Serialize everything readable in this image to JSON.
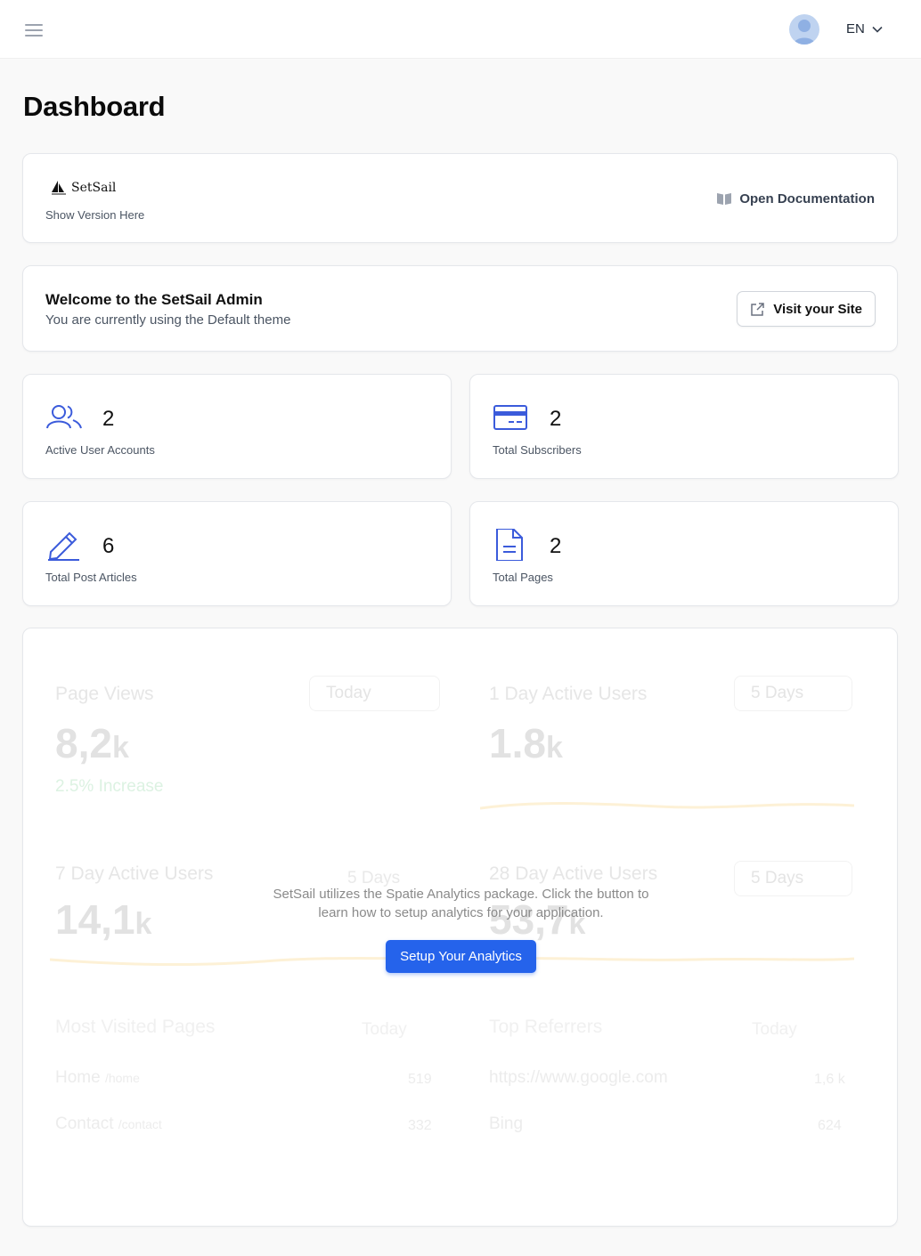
{
  "header": {
    "language": "EN"
  },
  "page": {
    "title": "Dashboard"
  },
  "version_card": {
    "logo_text": "SetSail",
    "version_text": "Show Version Here",
    "docs_label": "Open Documentation"
  },
  "welcome_card": {
    "heading": "Welcome to the SetSail Admin",
    "subtext": "You are currently using the Default theme",
    "visit_label": "Visit your Site"
  },
  "stats": [
    {
      "value": "2",
      "label": "Active User Accounts",
      "icon": "users-icon"
    },
    {
      "value": "2",
      "label": "Total Subscribers",
      "icon": "credit-card-icon"
    },
    {
      "value": "6",
      "label": "Total Post Articles",
      "icon": "pencil-icon"
    },
    {
      "value": "2",
      "label": "Total Pages",
      "icon": "document-icon"
    }
  ],
  "analytics": {
    "message_line1": "SetSail utilizes the Spatie Analytics package. Click the button to",
    "message_line2": "learn how to setup analytics for your application.",
    "button_label": "Setup Your Analytics",
    "placeholder": {
      "page_views": {
        "title": "Page Views",
        "range": "Today",
        "value": "8,2",
        "unit": "k",
        "increase": "2.5% Increase"
      },
      "day1": {
        "title": "1 Day Active Users",
        "range": "5 Days",
        "value": "1.8",
        "unit": "k"
      },
      "day7": {
        "title": "7 Day Active Users",
        "range": "5 Days",
        "value": "14,1",
        "unit": "k"
      },
      "day28": {
        "title": "28 Day Active Users",
        "range": "5 Days",
        "value": "53,7",
        "unit": "k"
      },
      "most_visited": {
        "title": "Most Visited Pages",
        "range": "Today",
        "rows": [
          {
            "name": "Home",
            "slug": "/home",
            "count": "519"
          },
          {
            "name": "Contact",
            "slug": "/contact",
            "count": "332"
          }
        ]
      },
      "referrers": {
        "title": "Top Referrers",
        "range": "Today",
        "rows": [
          {
            "name": "https://www.google.com",
            "count": "1,6 k"
          },
          {
            "name": "Bing",
            "count": "624"
          }
        ]
      }
    }
  },
  "colors": {
    "accent": "#2563eb",
    "icon_blue": "#3b5bdb"
  }
}
